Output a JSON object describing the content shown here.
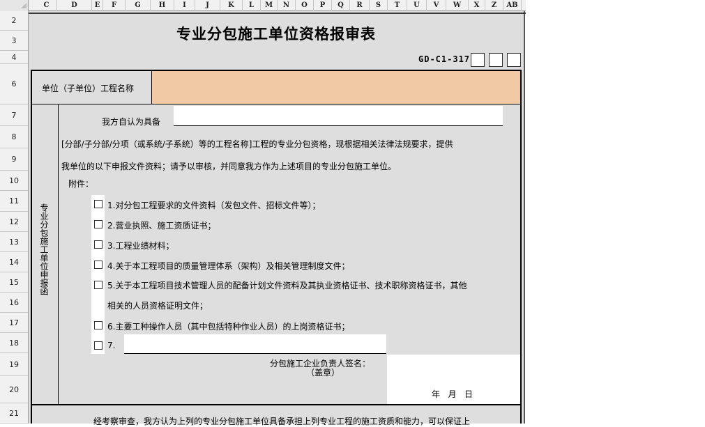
{
  "columns": [
    "C",
    "D",
    "E",
    "F",
    "G",
    "H",
    "I",
    "J",
    "K",
    "L",
    "M",
    "N",
    "O",
    "P",
    "Q",
    "R",
    "S",
    "T",
    "U",
    "V",
    "W",
    "X",
    "Z",
    "AB"
  ],
  "rows": [
    "2",
    "3",
    "4",
    "6",
    "7",
    "8",
    "9",
    "10",
    "11",
    "12",
    "13",
    "14",
    "15",
    "16",
    "17",
    "18",
    "19",
    "20",
    "21"
  ],
  "form": {
    "title": "专业分包施工单位资格报审表",
    "code": "GD-C1-317",
    "project_label": "单位（子单位）工程名称",
    "project_value": "",
    "side_label": "专业分包施工单位申报函",
    "intro_prefix": "我方自认为具备",
    "intro_value": "",
    "para_line1": "[分部/子分部/分项（或系统/子系统）等的工程名称]工程的专业分包资格，现根据相关法律法规要求，提供",
    "para_line2": "我单位的以下申报文件资料；请予以审核，并同意我方作为上述项目的专业分包施工单位。",
    "attach_label": "附件：",
    "items": [
      "1.对分包工程要求的文件资料（发包文件、招标文件等）；",
      "2.营业执照、施工资质证书；",
      "3.工程业绩材料；",
      "4.关于本工程项目的质量管理体系（架构）及相关管理制度文件；",
      "5.关于本工程项目技术管理人员的配备计划文件资料及其执业资格证书、技术职称资格证书，其他",
      "相关的人员资格证明文件；",
      "6.主要工种操作人员（其中包括特种作业人员）的上岗资格证书；",
      "7."
    ],
    "item7_value": "",
    "sign_label": "分包施工企业负责人签名：",
    "seal_label": "（盖章）",
    "date_label": "年   月   日",
    "review_text": "经考察审查，我方认为上列的专业分包施工单位具备承担上列专业工程的施工资质和能力，可以保证上"
  },
  "colors": {
    "highlight": "#f2c9a5",
    "sheet_bg": "#dedede",
    "header_bg": "#f1f1f1"
  }
}
